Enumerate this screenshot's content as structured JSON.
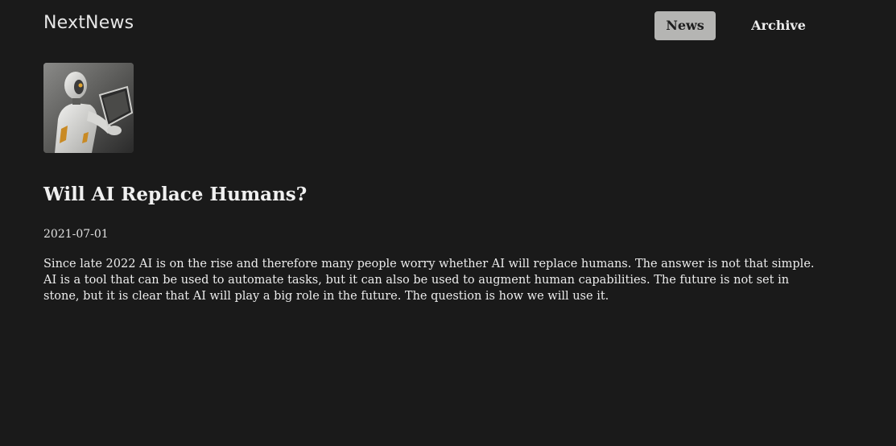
{
  "header": {
    "logo": "NextNews",
    "nav": [
      {
        "label": "News",
        "active": true
      },
      {
        "label": "Archive",
        "active": false
      }
    ]
  },
  "article": {
    "image_alt": "robot-with-tablet",
    "title": "Will AI Replace Humans?",
    "date": "2021-07-01",
    "body": "Since late 2022 AI is on the rise and therefore many people worry whether AI will replace humans. The answer is not that simple. AI is a tool that can be used to automate tasks, but it can also be used to augment human capabilities. The future is not set in stone, but it is clear that AI will play a big role in the future. The question is how we will use it."
  },
  "colors": {
    "background": "#1a1a1a",
    "active_nav_bg": "#b5b5b3",
    "text": "#e8e8e8"
  }
}
